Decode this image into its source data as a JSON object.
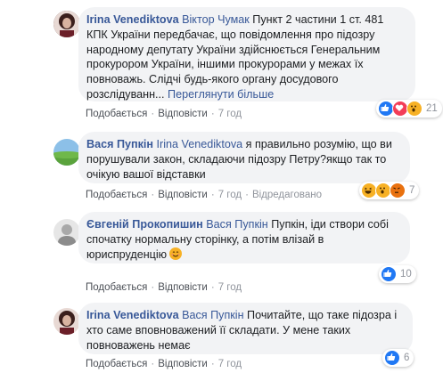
{
  "comments": [
    {
      "author": "Irina Venediktova",
      "mention": "Віктор Чумак",
      "text": " Пункт 2 частини 1 ст. 481 КПК України передбачає, що повідомлення про підозру народному депутату України здійснюється Генеральним прокурором України, іншими прокурорами у межах їх повноважь. Слідчі будь-якого органу досудового розслідуванн...",
      "see_more": " Переглянути більше",
      "like": "Подобається",
      "reply": "Відповісти",
      "time": "7 год",
      "edited": "",
      "reaction_count": "21",
      "reaction_types": [
        "like-icon",
        "love-icon",
        "wow-icon"
      ]
    },
    {
      "author": "Вася Пупкін",
      "mention": "Irina Venediktova",
      "text": " я правильно розумію, що ви порушували закон, складаючи підозру Петру?якщо так то очікую вашої відставки",
      "like": "Подобається",
      "reply": "Відповісти",
      "time": "7 год",
      "edited": "Відредаговано",
      "reaction_count": "7",
      "reaction_types": [
        "haha-icon",
        "wow-icon",
        "angry-icon"
      ]
    },
    {
      "author": "Євгеній Прокопишин",
      "mention": "Вася Пупкін",
      "text": " Пупкін, іди створи собі спочатку нормальну сторінку, а потім влізай в юриспруденцію",
      "emoji": "smiling-face-icon",
      "like": "Подобається",
      "reply": "Відповісти",
      "time": "7 год",
      "edited": "",
      "reaction_count": "10",
      "reaction_types": [
        "like-icon"
      ]
    },
    {
      "author": "Irina Venediktova",
      "mention": "Вася Пупкін",
      "text": " Почитайте, що таке підозра і хто саме вповноважений її складати. У мене таких повноважень немає",
      "like": "Подобається",
      "reply": "Відповісти",
      "time": "7 год",
      "edited": "",
      "reaction_count": "6",
      "reaction_types": [
        "like-icon"
      ]
    }
  ],
  "colors": {
    "link": "#385898",
    "bubble": "#f2f3f5",
    "meta": "#90949c"
  }
}
